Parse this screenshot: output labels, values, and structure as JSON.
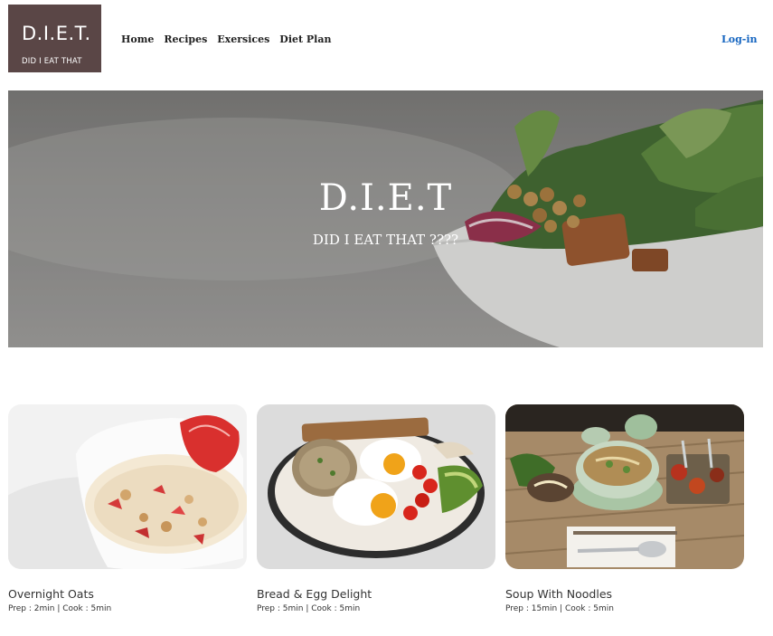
{
  "logo": {
    "title": "D.I.E.T.",
    "subtitle": "DID I EAT THAT"
  },
  "nav": {
    "items": [
      "Home",
      "Recipes",
      "Exersices",
      "Diet Plan"
    ],
    "login": "Log-in"
  },
  "hero": {
    "title": "D.I.E.T",
    "subtitle": "DID I EAT THAT ????"
  },
  "recipes": [
    {
      "title": "Overnight Oats",
      "meta": "Prep : 2min | Cook : 5min"
    },
    {
      "title": "Bread & Egg Delight",
      "meta": "Prep : 5min | Cook : 5min"
    },
    {
      "title": "Soup With Noodles",
      "meta": "Prep : 15min | Cook : 5min"
    }
  ],
  "colors": {
    "logo_bg": "#5a4646",
    "login": "#1565c0",
    "text": "#222222"
  }
}
